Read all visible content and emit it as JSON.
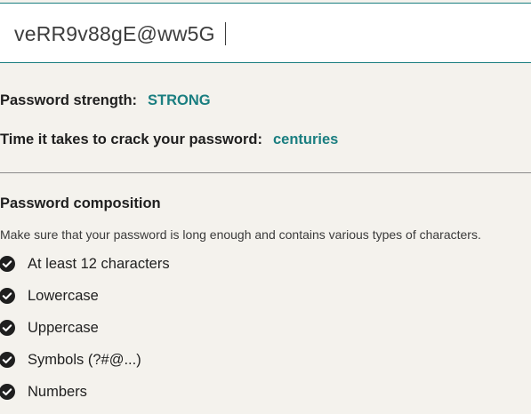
{
  "password_input": {
    "value": "veRR9v88gE@ww5G"
  },
  "strength": {
    "label": "Password strength:",
    "value": "STRONG"
  },
  "crack_time": {
    "label": "Time it takes to crack your password:",
    "value": "centuries"
  },
  "composition": {
    "title": "Password composition",
    "description": "Make sure that your password is long enough and contains various types of characters.",
    "requirements": [
      {
        "label": "At least 12 characters",
        "icon": "check-circle-icon",
        "met": true
      },
      {
        "label": "Lowercase",
        "icon": "check-circle-icon",
        "met": true
      },
      {
        "label": "Uppercase",
        "icon": "check-circle-icon",
        "met": true
      },
      {
        "label": "Symbols (?#@...)",
        "icon": "check-circle-icon",
        "met": true
      },
      {
        "label": "Numbers",
        "icon": "check-circle-icon",
        "met": true
      }
    ]
  },
  "colors": {
    "accent": "#1a7e80",
    "background": "#f4f2ed",
    "input_background": "#ffffff",
    "text": "#1f1f1f"
  }
}
